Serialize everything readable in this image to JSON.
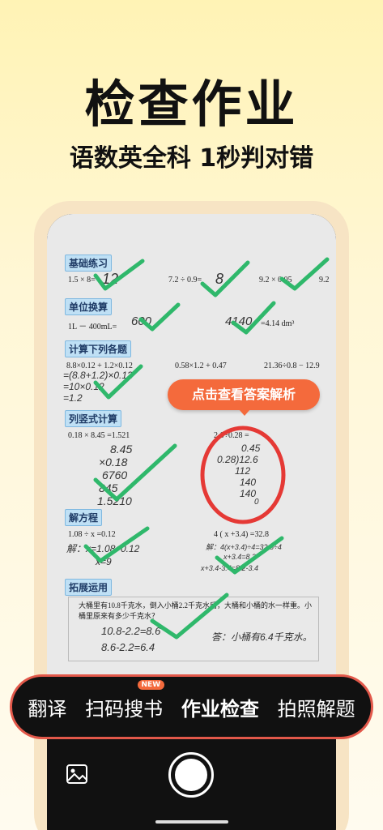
{
  "headline": "检查作业",
  "subhead": "语数英全科 1秒判对错",
  "worksheet": {
    "sections": [
      "基础练习",
      "单位换算",
      "计算下列各题",
      "列竖式计算",
      "解方程",
      "拓展运用"
    ],
    "basic": {
      "q1": "1.5 × 8=",
      "a1": "12",
      "q2": "7.2 ÷ 0.9=",
      "a2": "8",
      "q3": "9.2 × 0.05",
      "a3": "9.2"
    },
    "unit": {
      "q1": "1L － 400mL=",
      "a1": "600",
      "q2_suffix": "=4.14 dm³",
      "a2": "4140"
    },
    "calc": {
      "q1": "8.8×0.12 + 1.2×0.12",
      "w1": "=(8.8+1.2)×0.12",
      "w2": "=10×0.12",
      "w3": "=1.2",
      "q2": "0.58×1.2 + 0.47",
      "q3": "21.36÷0.8 − 12.9"
    },
    "vertical": {
      "q1": "0.18 × 8.45 =1.521",
      "w1": "8.45",
      "w2": "×0.18",
      "w3": "6760",
      "w4": "845",
      "w5": "1.5210",
      "q2": "2.6÷0.28 =",
      "d1": "0.45",
      "d2": "0.28)12.6",
      "d3": "112",
      "d4": "140",
      "d5": "140",
      "d6": "0"
    },
    "equation": {
      "q1": "1.08 ÷ x =0.12",
      "w1": "解：x=1.08÷0.12",
      "w2": "x=9",
      "q2": "4 ( x +3.4) =32.8",
      "w3": "解：4(x+3.4)÷4=32.8÷4",
      "w4": "x+3.4=8.2",
      "w5": "x+3.4-3.4=8.2-3.4"
    },
    "extension": {
      "problem": "大桶里有10.8千克水，倒入小桶2.2千克水后，大桶和小桶的水一样重。小桶里原来有多少千克水？",
      "w1": "10.8-2.2=8.6",
      "w2": "8.6-2.2=6.4",
      "answer": "答：小桶有6.4千克水。"
    }
  },
  "tooltip": "点击查看答案解析",
  "modes": [
    {
      "label": "翻译",
      "active": false
    },
    {
      "label": "扫码搜书",
      "active": false,
      "badge": "NEW"
    },
    {
      "label": "作业检查",
      "active": true
    },
    {
      "label": "拍照解题",
      "active": false
    }
  ],
  "colors": {
    "check": "#2fb86b",
    "error_circle": "#e53935",
    "accent": "#f46a3c"
  },
  "icons": {
    "gallery": "image-icon",
    "shutter": "shutter-button"
  }
}
